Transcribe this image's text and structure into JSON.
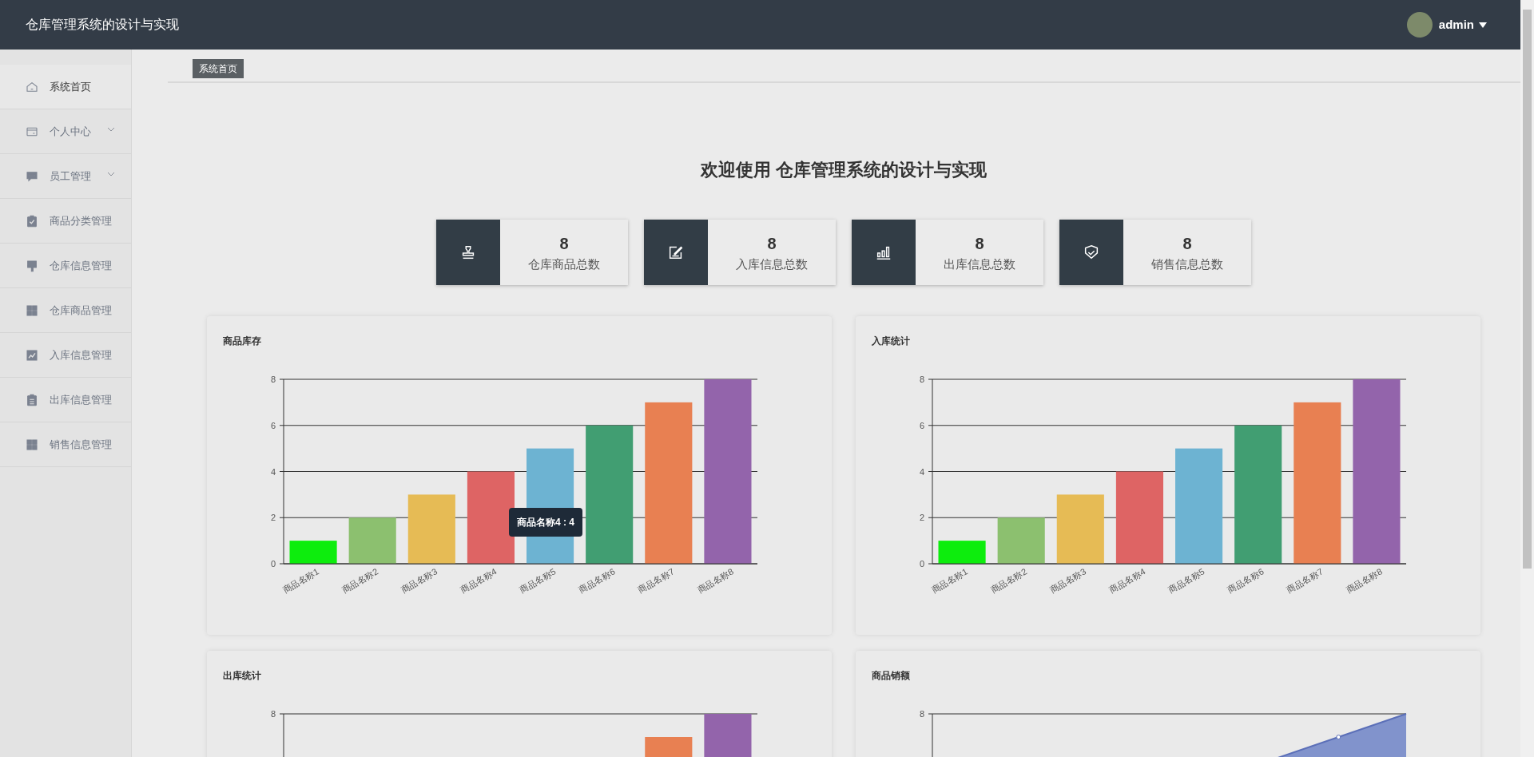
{
  "header": {
    "title": "仓库管理系统的设计与实现",
    "user": {
      "name": "admin"
    }
  },
  "sidebar": {
    "items": [
      {
        "label": "系统首页",
        "kind": "link",
        "selected": true
      },
      {
        "label": "个人中心",
        "kind": "group",
        "selected": false,
        "expanded": false
      },
      {
        "label": "员工管理",
        "kind": "group",
        "selected": false,
        "expanded": false
      },
      {
        "label": "商品分类管理",
        "kind": "link",
        "selected": false
      },
      {
        "label": "仓库信息管理",
        "kind": "link",
        "selected": false
      },
      {
        "label": "仓库商品管理",
        "kind": "link",
        "selected": false
      },
      {
        "label": "入库信息管理",
        "kind": "link",
        "selected": false
      },
      {
        "label": "出库信息管理",
        "kind": "link",
        "selected": false
      },
      {
        "label": "销售信息管理",
        "kind": "link",
        "selected": false
      }
    ]
  },
  "breadcrumb": [
    "系统首页"
  ],
  "welcome": "欢迎使用 仓库管理系统的设计与实现",
  "stats": [
    {
      "value": "8",
      "label": "仓库商品总数"
    },
    {
      "value": "8",
      "label": "入库信息总数"
    },
    {
      "value": "8",
      "label": "出库信息总数"
    },
    {
      "value": "8",
      "label": "销售信息总数"
    }
  ],
  "panels": [
    {
      "title": "商品库存",
      "kind": "chart",
      "tooltip": "商品名称4 : 4",
      "chart_data": {
        "type": "bar",
        "categories": [
          "商品名称1",
          "商品名称2",
          "商品名称3",
          "商品名称4",
          "商品名称5",
          "商品名称6",
          "商品名称7",
          "商品名称8"
        ],
        "colors": [
          "#0ded0d",
          "#8cc06f",
          "#e6bb55",
          "#de6464",
          "#6db3d2",
          "#419e72",
          "#e88052",
          "#9364ab"
        ],
        "ylim": [
          0,
          8
        ],
        "yticks": [
          0,
          2,
          4,
          6,
          8
        ],
        "grid": true,
        "series": [
          {
            "values": [
              1,
              2,
              3,
              4,
              5,
              6,
              7,
              8
            ]
          }
        ]
      }
    },
    {
      "title": "入库统计",
      "kind": "chart",
      "chart_data": {
        "type": "bar",
        "categories": [
          "商品名称1",
          "商品名称2",
          "商品名称3",
          "商品名称4",
          "商品名称5",
          "商品名称6",
          "商品名称7",
          "商品名称8"
        ],
        "colors": [
          "#0ded0d",
          "#8cc06f",
          "#e6bb55",
          "#de6464",
          "#6db3d2",
          "#419e72",
          "#e88052",
          "#9364ab"
        ],
        "ylim": [
          0,
          8
        ],
        "yticks": [
          0,
          2,
          4,
          6,
          8
        ],
        "grid": true,
        "series": [
          {
            "values": [
              1,
              2,
              3,
              4,
              5,
              6,
              7,
              8
            ]
          }
        ]
      }
    },
    {
      "title": "出库统计",
      "kind": "bar-picture",
      "top_tick": "8"
    },
    {
      "title": "商品销额",
      "kind": "area-picture",
      "top_tick": "8"
    }
  ]
}
